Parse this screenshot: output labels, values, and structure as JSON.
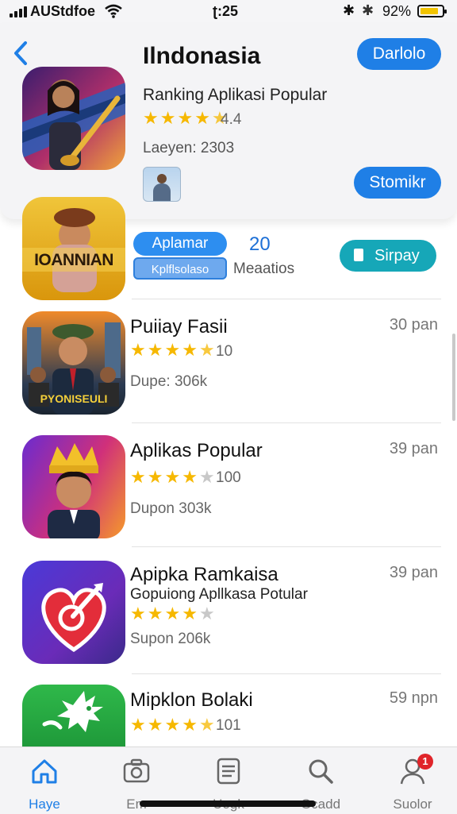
{
  "status_bar": {
    "carrier": "AUStdfoe",
    "time": "ʈ:25",
    "battery_pct": "92%",
    "battery_level": 0.85
  },
  "header": {
    "title": "Ilndonasia",
    "download_label": "Darlolo",
    "subtitle": "Ranking Aplikasi Popular",
    "rating": "4.4",
    "rating_stars": 4.5,
    "meta": "Laeyen: 2303",
    "secondary_button": "Stomikr"
  },
  "featured": {
    "icon_text": "IOANNIAN",
    "chip_label": "Aplamar",
    "chip2_label": "Kplflsolaso",
    "count": "20",
    "count_label": "Meaatios",
    "action_label": "Sirpay"
  },
  "apps": [
    {
      "name": "Puiiay Fasii",
      "rating": "10",
      "stars": 4.5,
      "size": "Dupe: 306k",
      "time": "30 pan",
      "icon_text": "PYONISEULI"
    },
    {
      "name": "Aplikas Popular",
      "rating": "100",
      "stars": 4,
      "size": "Dupon 303k",
      "time": "39 pan"
    },
    {
      "name": "Apipka Ramkaisa",
      "subtitle": "Gopuiong Apllkasa Potular",
      "stars": 4,
      "size": "Supon 206k",
      "time": "39 pan"
    },
    {
      "name": "Mipklon Bolaki",
      "rating": "101",
      "stars": 4.5,
      "time": "59 npn"
    }
  ],
  "tabs": [
    {
      "label": "Haye",
      "icon": "home-icon",
      "active": true
    },
    {
      "label": "Em",
      "icon": "camera-icon"
    },
    {
      "label": "Uogk",
      "icon": "list-icon"
    },
    {
      "label": "Gcadd",
      "icon": "search-icon"
    },
    {
      "label": "Suolor",
      "icon": "profile-icon",
      "badge": "1"
    }
  ],
  "colors": {
    "accent": "#1f7fe6",
    "teal": "#16a7b8",
    "star": "#f6b800",
    "badge": "#e0242a"
  }
}
